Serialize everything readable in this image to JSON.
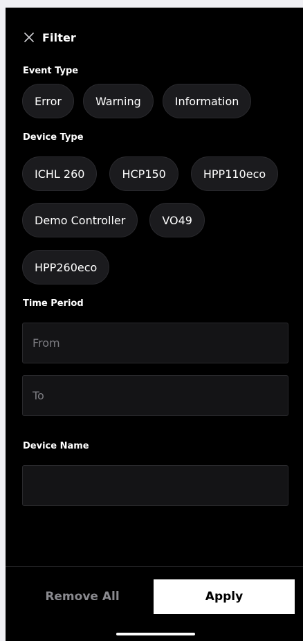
{
  "header": {
    "title": "Filter",
    "close_icon": "close-icon"
  },
  "event_type": {
    "label": "Event Type",
    "options": [
      "Error",
      "Warning",
      "Information"
    ]
  },
  "device_type": {
    "label": "Device Type",
    "options": [
      "ICHL 260",
      "HCP150",
      "HPP110eco",
      "Demo Controller",
      "VO49",
      "HPP260eco"
    ]
  },
  "time_period": {
    "label": "Time Period",
    "from_placeholder": "From",
    "to_placeholder": "To"
  },
  "device_name": {
    "label": "Device Name",
    "value": ""
  },
  "footer": {
    "remove_all_label": "Remove All",
    "apply_label": "Apply"
  },
  "colors": {
    "background": "#000000",
    "chip_background": "#1b1b1e",
    "field_background": "#141416",
    "apply_background": "#ffffff"
  }
}
